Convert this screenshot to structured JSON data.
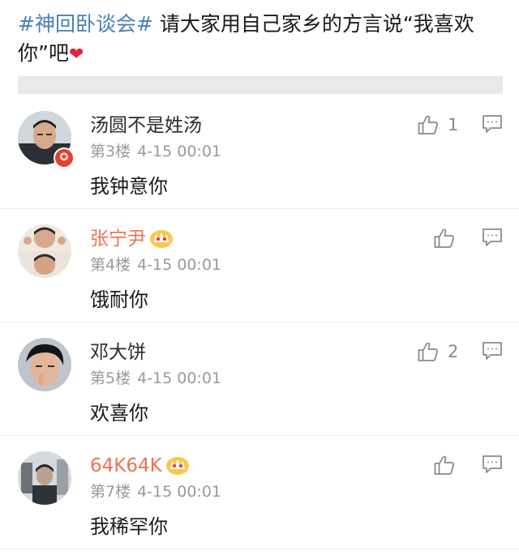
{
  "post": {
    "hashtag": "#神回卧谈会#",
    "text": " 请大家用自己家乡的方言说“我喜欢你”吧",
    "heart": "❤"
  },
  "comments": [
    {
      "username": "汤圆不是姓汤",
      "floor": "第3楼",
      "time": "4-15 00:01",
      "text": "我钟意你",
      "likes": "1",
      "verified": true,
      "vip": false
    },
    {
      "username": "张宁尹",
      "floor": "第4楼",
      "time": "4-15 00:01",
      "text": "饿耐你",
      "likes": "",
      "verified": false,
      "vip": true
    },
    {
      "username": "邓大饼",
      "floor": "第5楼",
      "time": "4-15 00:01",
      "text": "欢喜你",
      "likes": "2",
      "verified": false,
      "vip": false
    },
    {
      "username": "64K64K",
      "floor": "第7楼",
      "time": "4-15 00:01",
      "text": "我稀罕你",
      "likes": "",
      "verified": false,
      "vip": true
    }
  ],
  "icons": {
    "like": "thumbs-up-icon",
    "reply": "comment-reply-icon",
    "verified": "verified-badge-icon",
    "vip": "crown-icon"
  },
  "colors": {
    "hashtag": "#4a7fb8",
    "vip_name": "#eb7350",
    "meta": "#9a9a9a",
    "heart": "#e0243b",
    "verified_badge": "#e8402f"
  }
}
